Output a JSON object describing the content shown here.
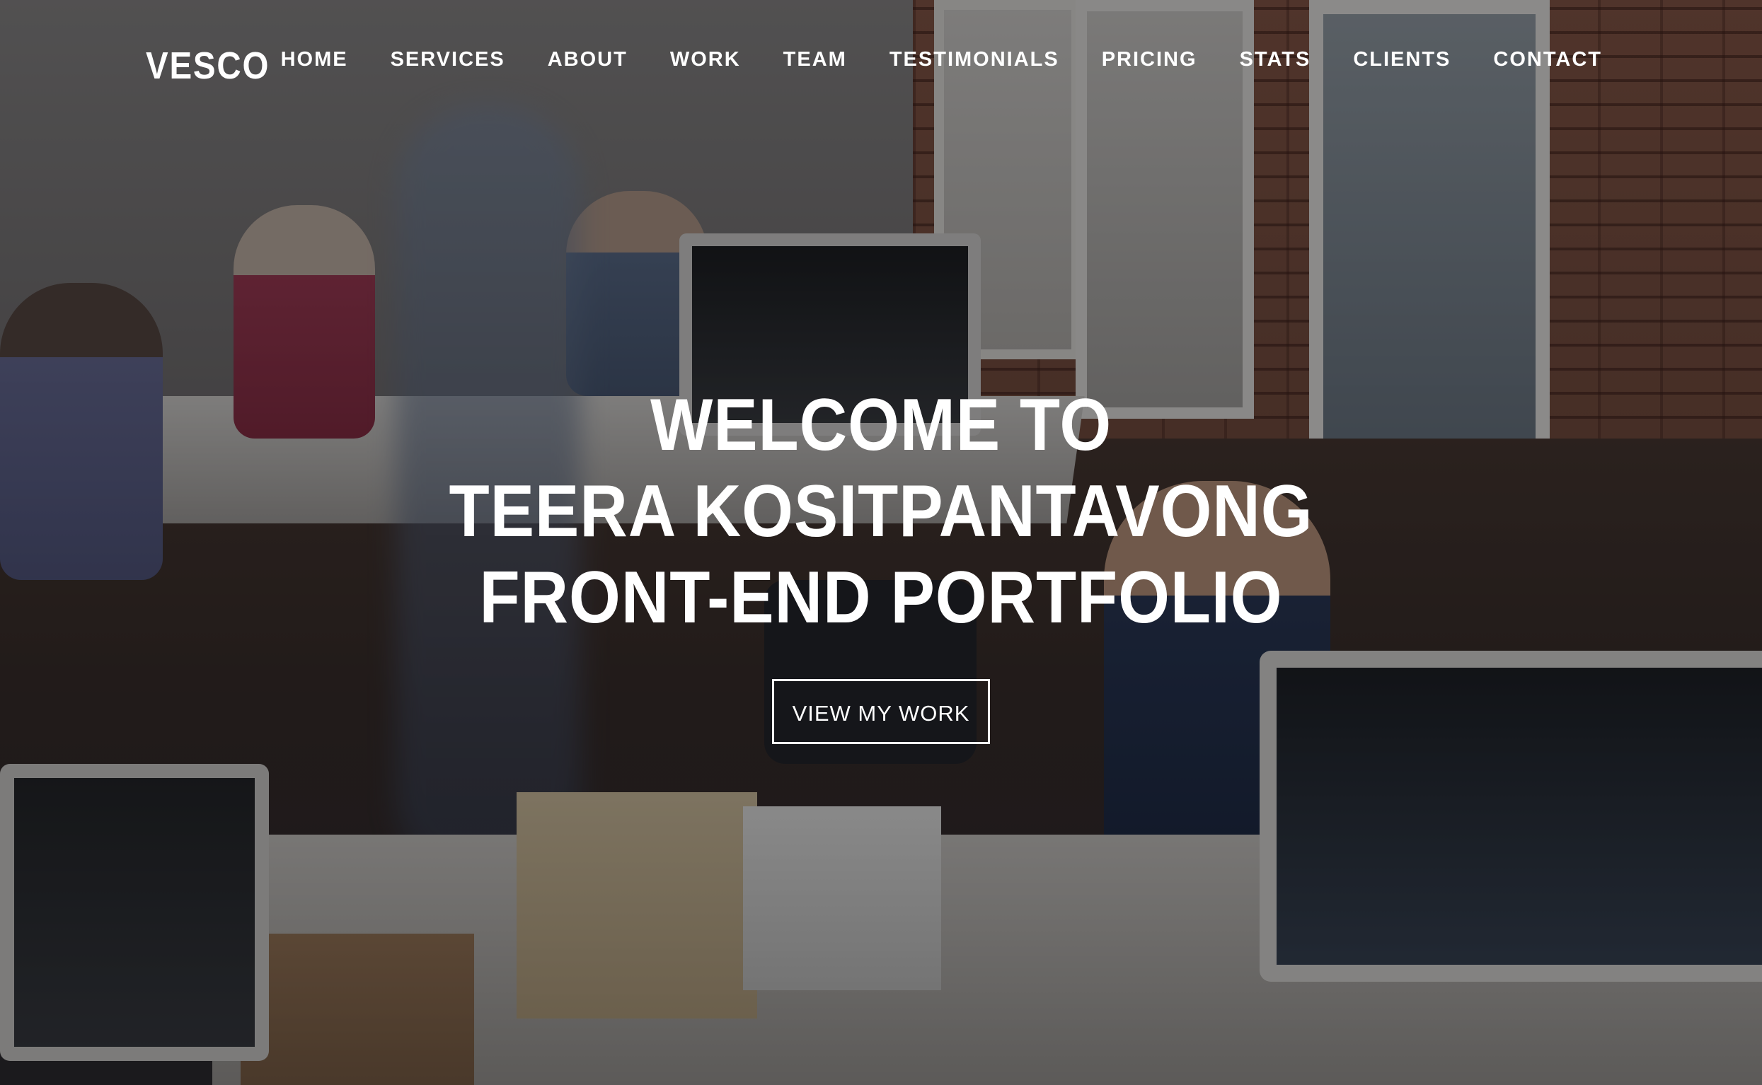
{
  "brand": {
    "logo_text": "VESCO"
  },
  "nav": {
    "items": [
      {
        "label": "HOME"
      },
      {
        "label": "SERVICES"
      },
      {
        "label": "ABOUT"
      },
      {
        "label": "WORK"
      },
      {
        "label": "TEAM"
      },
      {
        "label": "TESTIMONIALS"
      },
      {
        "label": "PRICING"
      },
      {
        "label": "STATS"
      },
      {
        "label": "CLIENTS"
      },
      {
        "label": "CONTACT"
      }
    ]
  },
  "hero": {
    "line1": "WELCOME TO",
    "line2": "TEERA KOSITPANTAVONG",
    "line3": "FRONT-END PORTFOLIO",
    "cta_label": "VIEW MY WORK"
  },
  "colors": {
    "text": "#ffffff",
    "overlay": "rgba(0,0,0,0.42)"
  }
}
